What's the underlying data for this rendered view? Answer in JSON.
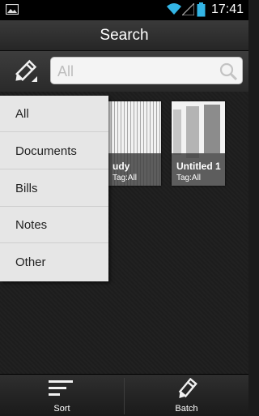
{
  "status_bar": {
    "time": "17:41"
  },
  "header": {
    "title": "Search"
  },
  "search": {
    "placeholder": "All"
  },
  "documents": [
    {
      "name": "udy",
      "tag": "Tag:All"
    },
    {
      "name": "Untitled 1",
      "tag": "Tag:All"
    }
  ],
  "filter_menu": {
    "options": [
      "All",
      "Documents",
      "Bills",
      "Notes",
      "Other"
    ]
  },
  "bottom_bar": {
    "sort_label": "Sort",
    "batch_label": "Batch"
  },
  "icons": [
    "image-icon",
    "wifi-icon",
    "signal-icon",
    "battery-icon",
    "pencil-icon",
    "search-icon",
    "sort-icon",
    "batch-pencil-icon"
  ]
}
